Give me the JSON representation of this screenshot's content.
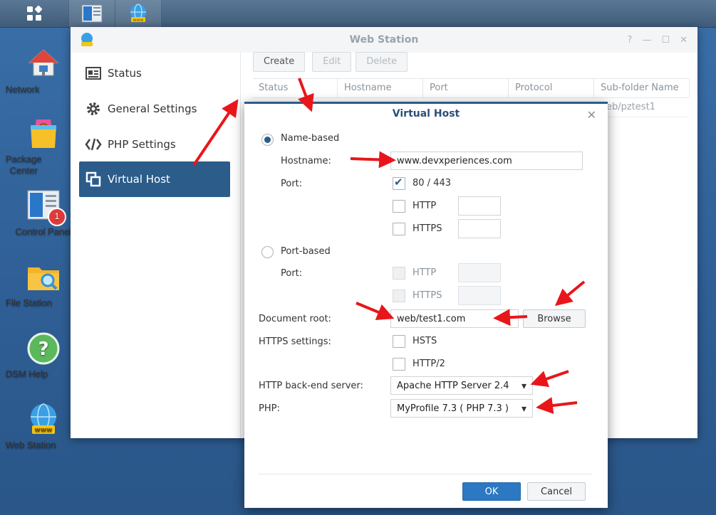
{
  "taskbar": {
    "items": [
      {
        "name": "main-menu"
      },
      {
        "name": "control-panel"
      },
      {
        "name": "web-station"
      }
    ]
  },
  "desktop": {
    "icons": [
      {
        "label": "Network",
        "icon": "network-icon"
      },
      {
        "label": "Package\nCenter",
        "icon": "package-center-icon"
      },
      {
        "label": "Control Panel",
        "icon": "control-panel-icon",
        "badge": "1"
      },
      {
        "label": "File Station",
        "icon": "file-station-icon"
      },
      {
        "label": "DSM Help",
        "icon": "dsm-help-icon"
      },
      {
        "label": "Web Station",
        "icon": "web-station-icon"
      }
    ]
  },
  "window": {
    "title": "Web Station",
    "controls": [
      "?",
      "—",
      "☐",
      "✕"
    ],
    "sidebar": [
      {
        "label": "Status",
        "icon": "status-icon"
      },
      {
        "label": "General Settings",
        "icon": "gear-icon"
      },
      {
        "label": "PHP Settings",
        "icon": "code-icon"
      },
      {
        "label": "Virtual Host",
        "icon": "virtual-host-icon",
        "active": true
      }
    ],
    "toolbar": {
      "create": "Create",
      "edit": "Edit",
      "delete": "Delete"
    },
    "columns": [
      "Status",
      "Hostname",
      "Port",
      "Protocol",
      "Sub-folder Name"
    ],
    "row_partial": "eb/pztest1"
  },
  "dialog": {
    "title": "Virtual Host",
    "close": "✕",
    "name_based": "Name-based",
    "hostname_label": "Hostname:",
    "hostname_value": "www.devxperiences.com",
    "port_label": "Port:",
    "port_80_443": "80 / 443",
    "http": "HTTP",
    "https": "HTTPS",
    "port_based": "Port-based",
    "port_label2": "Port:",
    "http2": "HTTP",
    "https2": "HTTPS",
    "doc_root_label": "Document root:",
    "doc_root_value": "web/test1.com",
    "browse": "Browse",
    "https_settings_label": "HTTPS settings:",
    "hsts": "HSTS",
    "http2_label": "HTTP/2",
    "backend_label": "HTTP back-end server:",
    "backend_value": "Apache HTTP Server 2.4",
    "php_label": "PHP:",
    "php_value": "MyProfile 7.3 ( PHP 7.3 )",
    "ok": "OK",
    "cancel": "Cancel"
  },
  "colors": {
    "accent": "#2b5c8a",
    "arrow": "#e8161b",
    "primary_button": "#2b79c2"
  }
}
